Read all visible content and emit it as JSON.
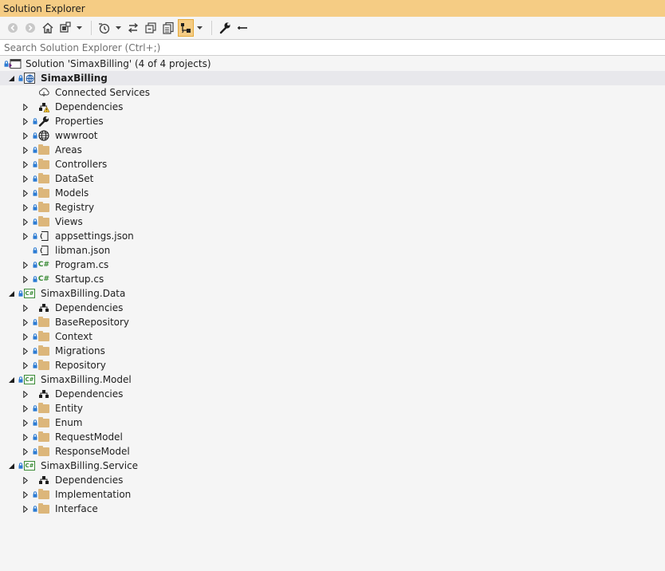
{
  "window": {
    "title": "Solution Explorer"
  },
  "toolbar": {
    "buttons": [
      {
        "icon": "back-icon"
      },
      {
        "icon": "forward-icon"
      },
      {
        "icon": "home-icon"
      },
      {
        "icon": "switch-views-icon"
      },
      {
        "icon": "pending-changes-filter-icon"
      },
      {
        "icon": "sync-with-active-document-icon"
      },
      {
        "icon": "collapse-all-icon"
      },
      {
        "icon": "show-all-files-icon"
      },
      {
        "icon": "preview-selected-items-icon"
      },
      {
        "icon": "properties-icon"
      },
      {
        "icon": "remove-icon"
      }
    ]
  },
  "search": {
    "placeholder": "Search Solution Explorer (Ctrl+;)"
  },
  "tree": {
    "solution": "Solution 'SimaxBilling' (4 of 4 projects)",
    "p1": {
      "name": "SimaxBilling",
      "items": [
        "Connected Services",
        "Dependencies",
        "Properties",
        "wwwroot",
        "Areas",
        "Controllers",
        "DataSet",
        "Models",
        "Registry",
        "Views",
        "appsettings.json",
        "libman.json",
        "Program.cs",
        "Startup.cs"
      ]
    },
    "p2": {
      "name": "SimaxBilling.Data",
      "items": [
        "Dependencies",
        "BaseRepository",
        "Context",
        "Migrations",
        "Repository"
      ]
    },
    "p3": {
      "name": "SimaxBilling.Model",
      "items": [
        "Dependencies",
        "Entity",
        "Enum",
        "RequestModel",
        "ResponseModel"
      ]
    },
    "p4": {
      "name": "SimaxBilling.Service",
      "items": [
        "Dependencies",
        "Implementation",
        "Interface"
      ]
    }
  },
  "colors": {
    "title_bar": "#f5cc84",
    "selected_row": "#e8e8ec",
    "folder": "#dcb67a",
    "lock": "#2b7bd3",
    "csharp": "#388a34"
  }
}
